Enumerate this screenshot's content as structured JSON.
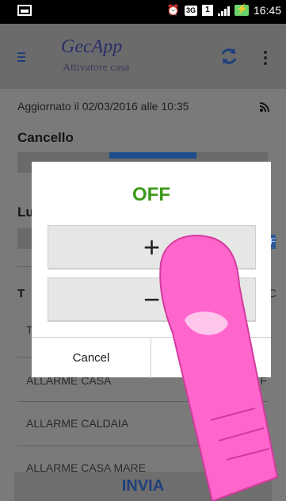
{
  "status_bar": {
    "time": "16:45",
    "network_badge": "3G",
    "sim_badge": "1",
    "icons": [
      "image-notification-icon",
      "alarm-icon",
      "3g-icon",
      "sim-icon",
      "signal-icon",
      "battery-charging-icon"
    ]
  },
  "appbar": {
    "title": "GecApp",
    "subtitle": "Attivatore casa",
    "icons": [
      "hamburger-icon",
      "refresh-icon",
      "overflow-menu-icon"
    ]
  },
  "content": {
    "updated": "Aggiornato il 02/03/2016 alle 10:35",
    "section_cancello": "Cancello",
    "section_luci_partial": "Lu",
    "list_header_partial": "T",
    "list_header_right_partial": "C",
    "row_partial_label": "T",
    "row_partial_chip": "FF",
    "items": [
      {
        "label": "ALLARME CASA",
        "right": "F"
      },
      {
        "label": "ALLARME CALDAIA",
        "right": "F"
      },
      {
        "label": "ALLARME CASA MARE",
        "right": ""
      }
    ],
    "send_button": "INVIA"
  },
  "dialog": {
    "title": "OFF",
    "plus": "+",
    "minus": "−",
    "cancel": "Cancel"
  },
  "colors": {
    "status_bar": "#000000",
    "accent_blue": "#1e3f7a",
    "off_green": "#3e9a1a",
    "finger_pink": "#ff66cc"
  }
}
